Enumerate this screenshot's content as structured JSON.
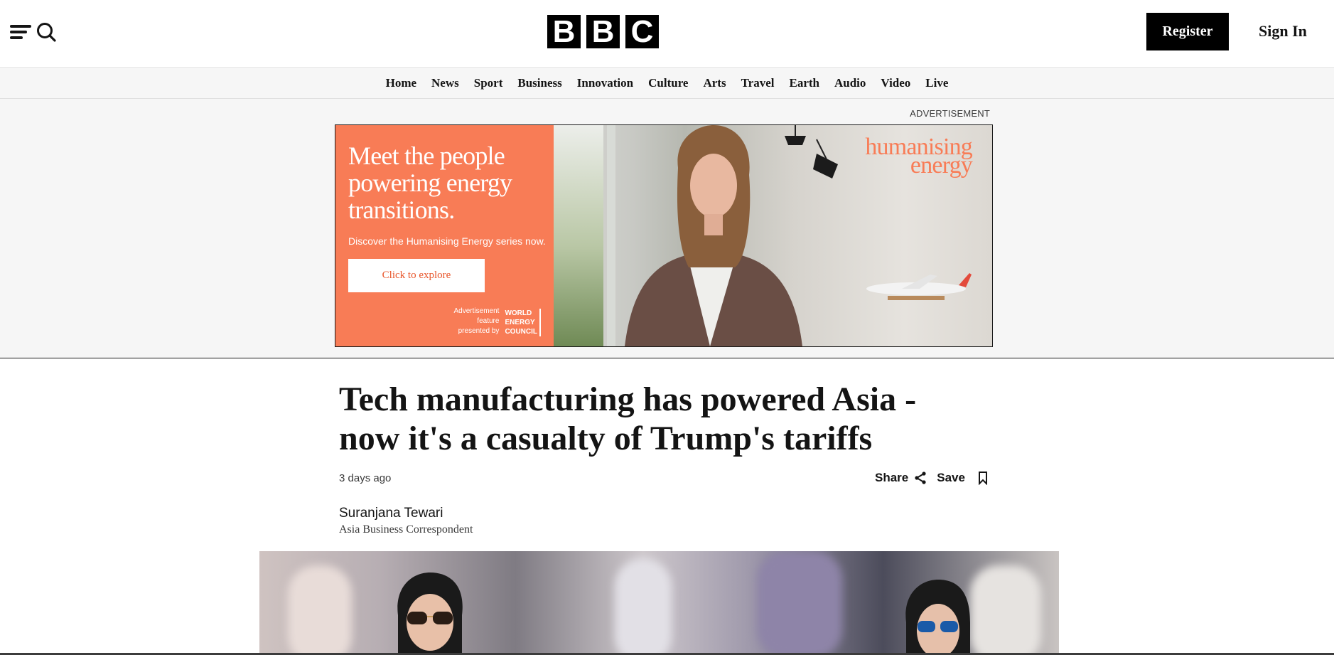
{
  "header": {
    "logo_letters": [
      "B",
      "B",
      "C"
    ],
    "register_label": "Register",
    "signin_label": "Sign In",
    "menu_icon": "menu-icon",
    "search_icon": "search-icon"
  },
  "nav": {
    "items": [
      "Home",
      "News",
      "Sport",
      "Business",
      "Innovation",
      "Culture",
      "Arts",
      "Travel",
      "Earth",
      "Audio",
      "Video",
      "Live"
    ]
  },
  "ad": {
    "label": "ADVERTISEMENT",
    "headline": "Meet the people powering energy transitions.",
    "subtext": "Discover the Humanising Energy series now.",
    "cta": "Click to explore",
    "feature_text": "Advertisement\nfeature\npresented by",
    "council_text": "WORLD\nENERGY\nCOUNCIL",
    "brand": "humanising\nenergy",
    "accent_color": "#f87c56"
  },
  "article": {
    "headline": "Tech manufacturing has powered Asia - now it's a casualty of Trump's tariffs",
    "timestamp": "3 days ago",
    "share_label": "Share",
    "save_label": "Save",
    "author": "Suranjana Tewari",
    "author_role": "Asia Business Correspondent"
  }
}
